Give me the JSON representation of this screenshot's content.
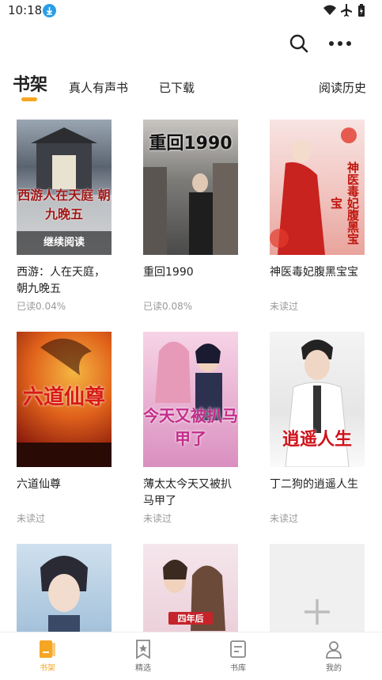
{
  "status": {
    "time": "10:18"
  },
  "tabs": [
    {
      "label": "书架",
      "active": true
    },
    {
      "label": "真人有声书",
      "active": false
    },
    {
      "label": "已下载",
      "active": false
    },
    {
      "label": "阅读历史",
      "active": false
    }
  ],
  "books": [
    {
      "title": "西游：人在天庭，朝九晚五",
      "progress": "已读0.04%",
      "cover_text": "西游人在天庭 朝九晚五",
      "continue_label": "继续阅读"
    },
    {
      "title": "重回1990",
      "progress": "已读0.08%",
      "cover_text": "重回1990"
    },
    {
      "title": "神医毒妃腹黑宝宝",
      "progress": "未读过",
      "cover_text": "神医毒妃腹黑宝宝"
    },
    {
      "title": "六道仙尊",
      "progress": "未读过",
      "cover_text": "六道仙尊"
    },
    {
      "title": "薄太太今天又被扒马甲了",
      "progress": "未读过",
      "cover_text": "今天又被扒马甲了"
    },
    {
      "title": "丁二狗的逍遥人生",
      "progress": "未读过",
      "cover_text": "逍遥人生"
    },
    {
      "title": "",
      "progress": ""
    },
    {
      "title": "",
      "progress": "",
      "cover_text": "四年后"
    }
  ],
  "add_book": {
    "icon": "plus-icon"
  },
  "bottom_nav": [
    {
      "label": "书架",
      "icon": "bookshelf-icon",
      "active": true
    },
    {
      "label": "精选",
      "icon": "featured-icon",
      "active": false
    },
    {
      "label": "书库",
      "icon": "library-icon",
      "active": false
    },
    {
      "label": "我的",
      "icon": "profile-icon",
      "active": false
    }
  ],
  "colors": {
    "accent": "#f5a623",
    "muted": "#999999"
  }
}
